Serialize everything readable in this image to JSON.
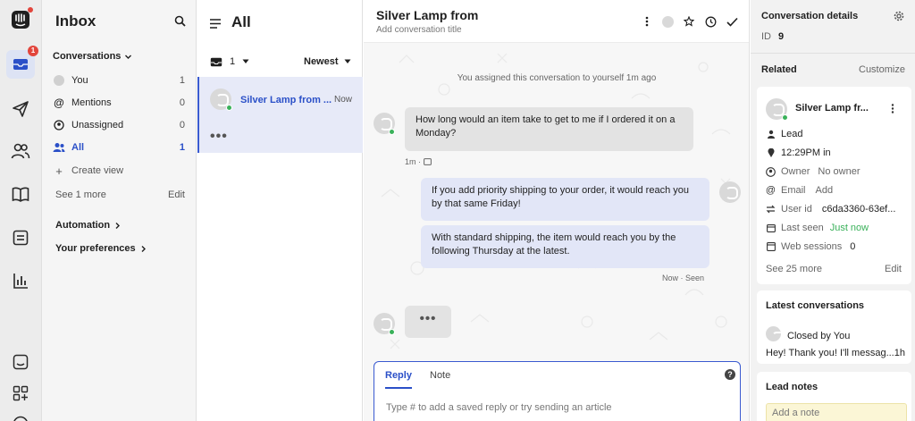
{
  "rail": {
    "inbox_badge": "1",
    "colors": {
      "active_bg": "#dde3f4",
      "badge": "#e2453c"
    }
  },
  "inbox": {
    "title": "Inbox",
    "conversations_label": "Conversations",
    "items": [
      {
        "label": "You",
        "count": "1"
      },
      {
        "label": "Mentions",
        "count": "0"
      },
      {
        "label": "Unassigned",
        "count": "0"
      },
      {
        "label": "All",
        "count": "1"
      }
    ],
    "create_view": "Create view",
    "see_more": "See 1 more",
    "edit": "Edit",
    "automation": "Automation",
    "preferences": "Your preferences"
  },
  "list": {
    "title": "All",
    "filter_count": "1",
    "sort": "Newest",
    "card": {
      "name": "Silver Lamp from ...",
      "time": "Now",
      "dots": "•••"
    }
  },
  "conversation": {
    "title": "Silver Lamp from",
    "subtitle": "Add conversation title",
    "system_note": "You assigned this conversation to yourself 1m ago",
    "messages": [
      {
        "text": "How long would an item take to get to me if I ordered it on a Monday?",
        "meta": "1m ·"
      },
      {
        "text": "If you add priority shipping to your order, it would reach you by that same Friday!"
      },
      {
        "text": "With standard shipping, the item would reach you by the following Thursday at the latest.",
        "meta": "Now · Seen"
      }
    ],
    "typing": "•••",
    "composer": {
      "reply_tab": "Reply",
      "note_tab": "Note",
      "placeholder": "Type # to add a saved reply or try sending an article",
      "help": "?"
    }
  },
  "details": {
    "title": "Conversation details",
    "id_label": "ID",
    "id_value": "9",
    "related": "Related",
    "customize": "Customize",
    "contact": {
      "name": "Silver Lamp fr...",
      "type": "Lead",
      "time": "12:29PM in",
      "owner_label": "Owner",
      "owner_value": "No owner",
      "email_label": "Email",
      "email_value": "Add",
      "userid_label": "User id",
      "userid_value": "c6da3360-63ef...",
      "lastseen_label": "Last seen",
      "lastseen_value": "Just now",
      "sessions_label": "Web sessions",
      "sessions_value": "0",
      "see_more": "See 25 more",
      "edit": "Edit"
    },
    "latest": {
      "title": "Latest conversations",
      "status": "Closed by You",
      "preview": "Hey! Thank you! I'll messag...1h"
    },
    "notes": {
      "title": "Lead notes",
      "placeholder": "Add a note"
    }
  }
}
